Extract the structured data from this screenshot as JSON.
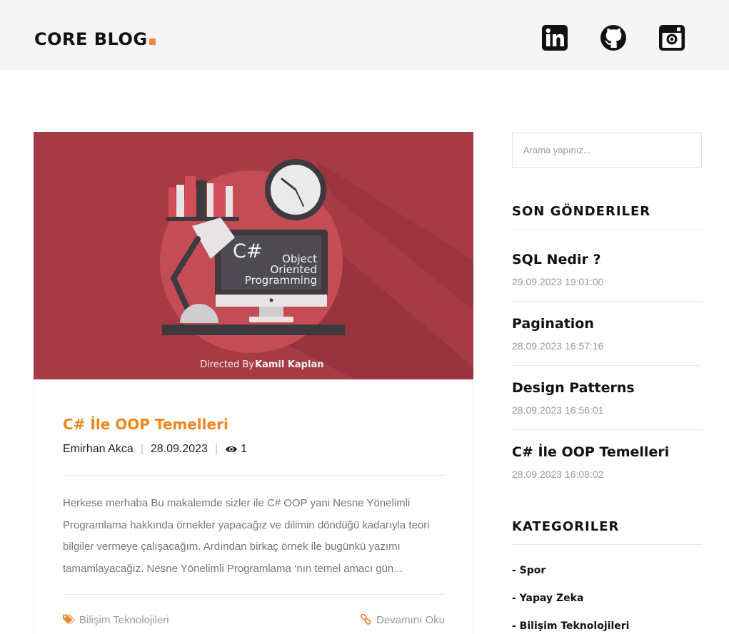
{
  "header": {
    "logo": "CORE BLOG",
    "social": [
      {
        "icon": "linkedin-icon"
      },
      {
        "icon": "github-icon"
      },
      {
        "icon": "instagram-icon"
      }
    ]
  },
  "post": {
    "image_caption_prefix": "Directed By",
    "image_caption_name": "Kamil Kaplan",
    "image_lang": "C#",
    "image_line1": "Object",
    "image_line2": "Oriented",
    "image_line3": "Programming",
    "title": "C# İle OOP Temelleri",
    "author": "Emirhan Akca",
    "date": "28.09.2023",
    "views": "1",
    "excerpt": "Herkese merhaba Bu makalemde sizler ile C# OOP yani Nesne Yönelimli Programlama hakkında örnekler yapacağız ve dilimin döndüğü kadarıyla teori bilgiler vermeye çalışacağım. Ardından birkaç örnek ile bugünkü yazımı tamamlayacağız. Nesne Yönelimli Programlama ‘nın temel amacı gün...",
    "category": "Bilişim Teknolojileri",
    "read_more": "Devamını Oku"
  },
  "sidebar": {
    "search_placeholder": "Arama yapınız...",
    "recent_title": "SON GÖNDERILER",
    "recent": [
      {
        "title": "SQL Nedir ?",
        "date": "29.09.2023 19:01:00"
      },
      {
        "title": "Pagination",
        "date": "28.09.2023 16:57:16"
      },
      {
        "title": "Design Patterns",
        "date": "28.09.2023 16:56:01"
      },
      {
        "title": "C# İle OOP Temelleri",
        "date": "28.09.2023 16:08:02"
      }
    ],
    "categories_title": "KATEGORILER",
    "categories": [
      "- Spor",
      "- Yapay Zeka",
      "- Bilişim Teknolojileri"
    ]
  },
  "colors": {
    "accent": "#f0883c",
    "title_orange": "#f0851f",
    "image_bg": "#a63a45",
    "header_bg": "#f5f5f5"
  }
}
